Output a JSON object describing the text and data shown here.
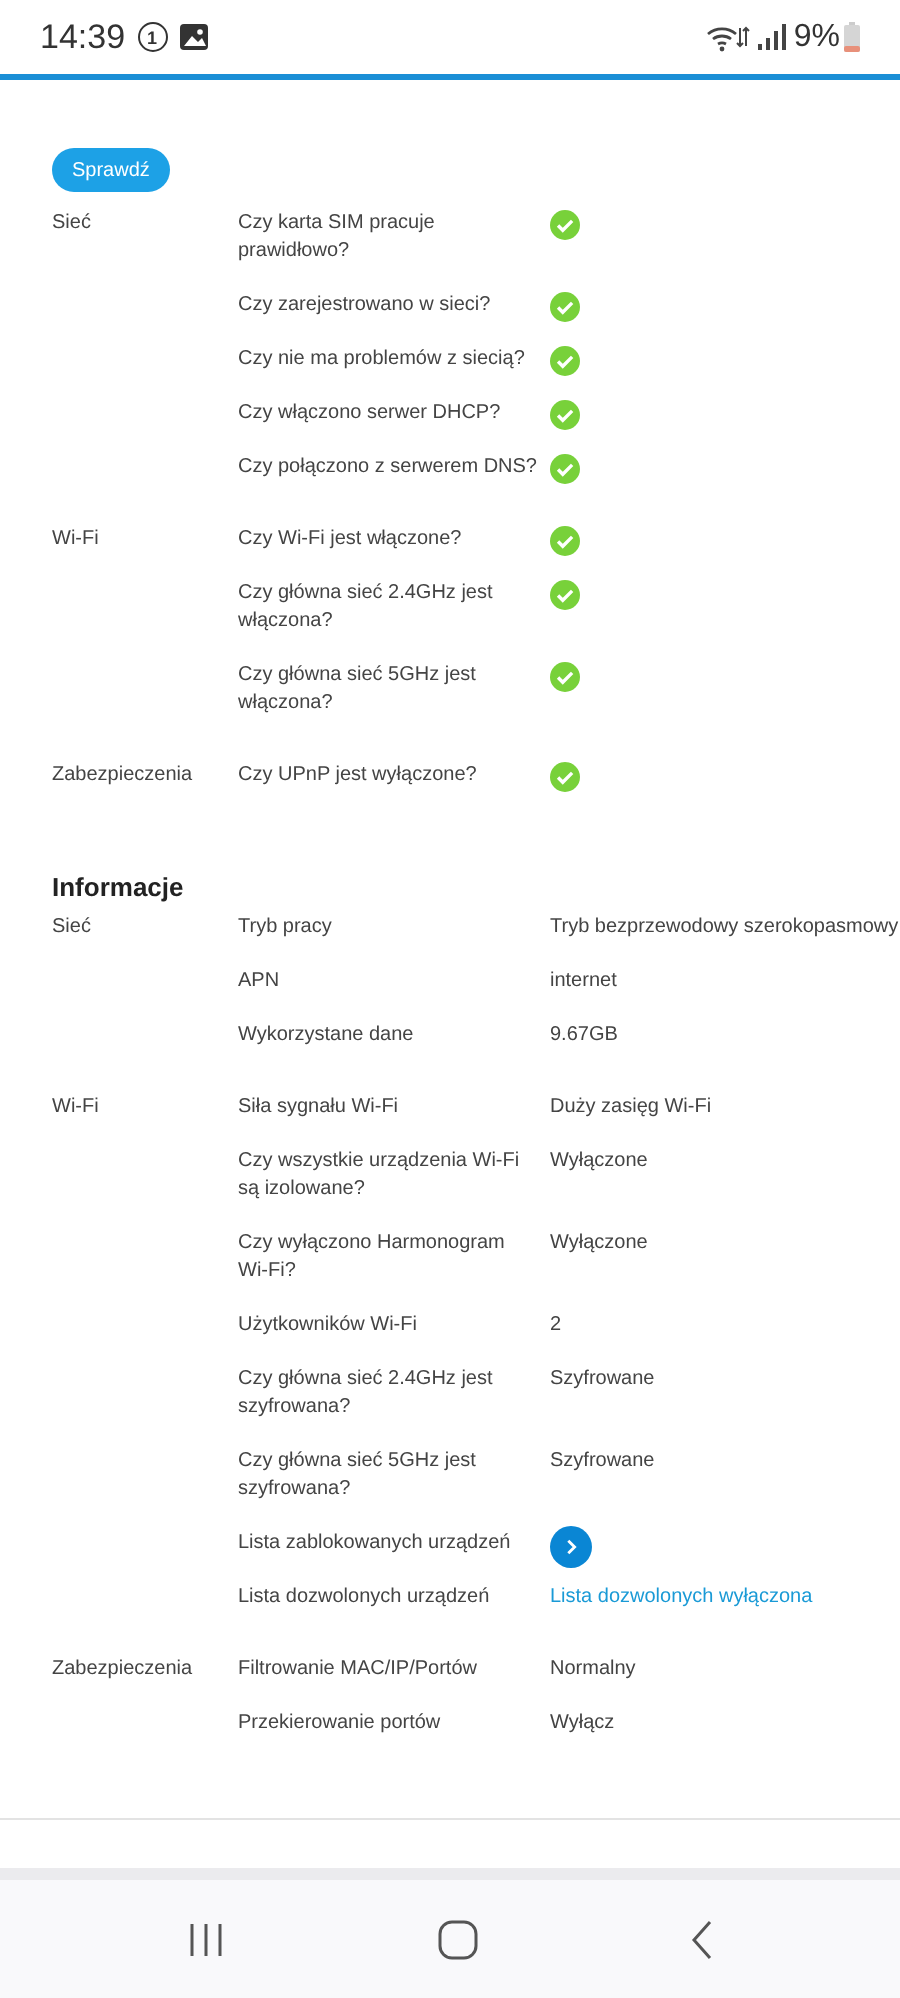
{
  "status_bar": {
    "time": "14:39",
    "notification_count": "1",
    "battery": "9%"
  },
  "check_button": "Sprawdź",
  "checks": [
    {
      "label": "Sieć",
      "items": [
        {
          "question": "Czy karta SIM pracuje prawidłowo?",
          "passed": true
        },
        {
          "question": "Czy zarejestrowano w sieci?",
          "passed": true
        },
        {
          "question": "Czy nie ma problemów z siecią?",
          "passed": true
        },
        {
          "question": "Czy włączono serwer DHCP?",
          "passed": true
        },
        {
          "question": "Czy połączono z serwerem DNS?",
          "passed": true
        }
      ]
    },
    {
      "label": "Wi-Fi",
      "items": [
        {
          "question": "Czy Wi-Fi jest włączone?",
          "passed": true
        },
        {
          "question": "Czy główna sieć 2.4GHz jest włączona?",
          "passed": true
        },
        {
          "question": "Czy główna sieć 5GHz jest włączona?",
          "passed": true
        }
      ]
    },
    {
      "label": "Zabezpieczenia",
      "items": [
        {
          "question": "Czy UPnP jest wyłączone?",
          "passed": true
        }
      ]
    }
  ],
  "info": {
    "title": "Informacje",
    "groups": [
      {
        "label": "Sieć",
        "items": [
          {
            "label": "Tryb pracy",
            "kind": "text",
            "value": "Tryb bezprzewodowy szerokopasmowy"
          },
          {
            "label": "APN",
            "kind": "text",
            "value": "internet"
          },
          {
            "label": "Wykorzystane dane",
            "kind": "text",
            "value": "9.67GB"
          }
        ]
      },
      {
        "label": "Wi-Fi",
        "items": [
          {
            "label": "Siła sygnału Wi-Fi",
            "kind": "text",
            "value": "Duży zasięg Wi-Fi"
          },
          {
            "label": "Czy wszystkie urządzenia Wi-Fi są izolowane?",
            "kind": "text",
            "value": "Wyłączone"
          },
          {
            "label": "Czy wyłączono Harmonogram Wi-Fi?",
            "kind": "text",
            "value": "Wyłączone"
          },
          {
            "label": "Użytkowników Wi-Fi",
            "kind": "text",
            "value": "2"
          },
          {
            "label": "Czy główna sieć 2.4GHz jest szyfrowana?",
            "kind": "text",
            "value": "Szyfrowane"
          },
          {
            "label": "Czy główna sieć 5GHz jest szyfrowana?",
            "kind": "text",
            "value": "Szyfrowane"
          },
          {
            "label": "Lista zablokowanych urządzeń",
            "kind": "arrow_button"
          },
          {
            "label": "Lista dozwolonych urządzeń",
            "kind": "link",
            "value": "Lista dozwolonych wyłączona"
          }
        ]
      },
      {
        "label": "Zabezpieczenia",
        "items": [
          {
            "label": "Filtrowanie MAC/IP/Portów",
            "kind": "text",
            "value": "Normalny"
          },
          {
            "label": "Przekierowanie portów",
            "kind": "text",
            "value": "Wyłącz"
          }
        ]
      }
    ]
  }
}
